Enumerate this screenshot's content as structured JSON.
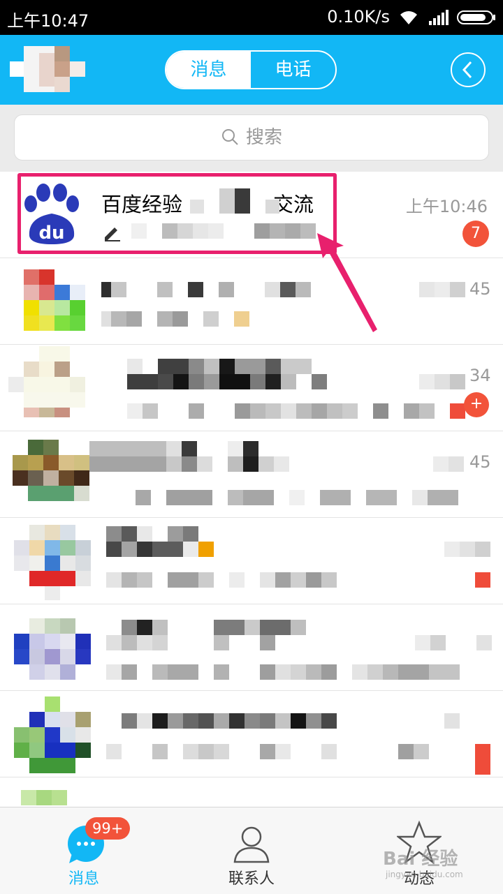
{
  "status_bar": {
    "time": "上午10:47",
    "speed": "0.10K/s"
  },
  "header": {
    "tabs": [
      {
        "label": "消息",
        "active": true
      },
      {
        "label": "电话",
        "active": false
      }
    ],
    "back_icon": "chevron-left-icon"
  },
  "search": {
    "placeholder": "搜索",
    "icon": "search-icon"
  },
  "conversations": [
    {
      "name_start": "百度经验",
      "name_end": "交流",
      "time": "上午10:46",
      "unread": "7",
      "icon": "baidu-paw-logo"
    },
    {
      "time_tail": "45"
    },
    {
      "time_tail": "34"
    },
    {
      "time_tail": "45"
    }
  ],
  "bottom_nav": {
    "items": [
      {
        "label": "消息",
        "badge": "99+",
        "active": true
      },
      {
        "label": "联系人",
        "active": false
      },
      {
        "label": "动态",
        "active": false
      }
    ]
  },
  "watermark": {
    "text": "Bai 经验",
    "url": "jingyan.baidu.com"
  },
  "colors": {
    "accent": "#12b7f5",
    "badge": "#f2533a",
    "highlight": "#e8206d"
  }
}
